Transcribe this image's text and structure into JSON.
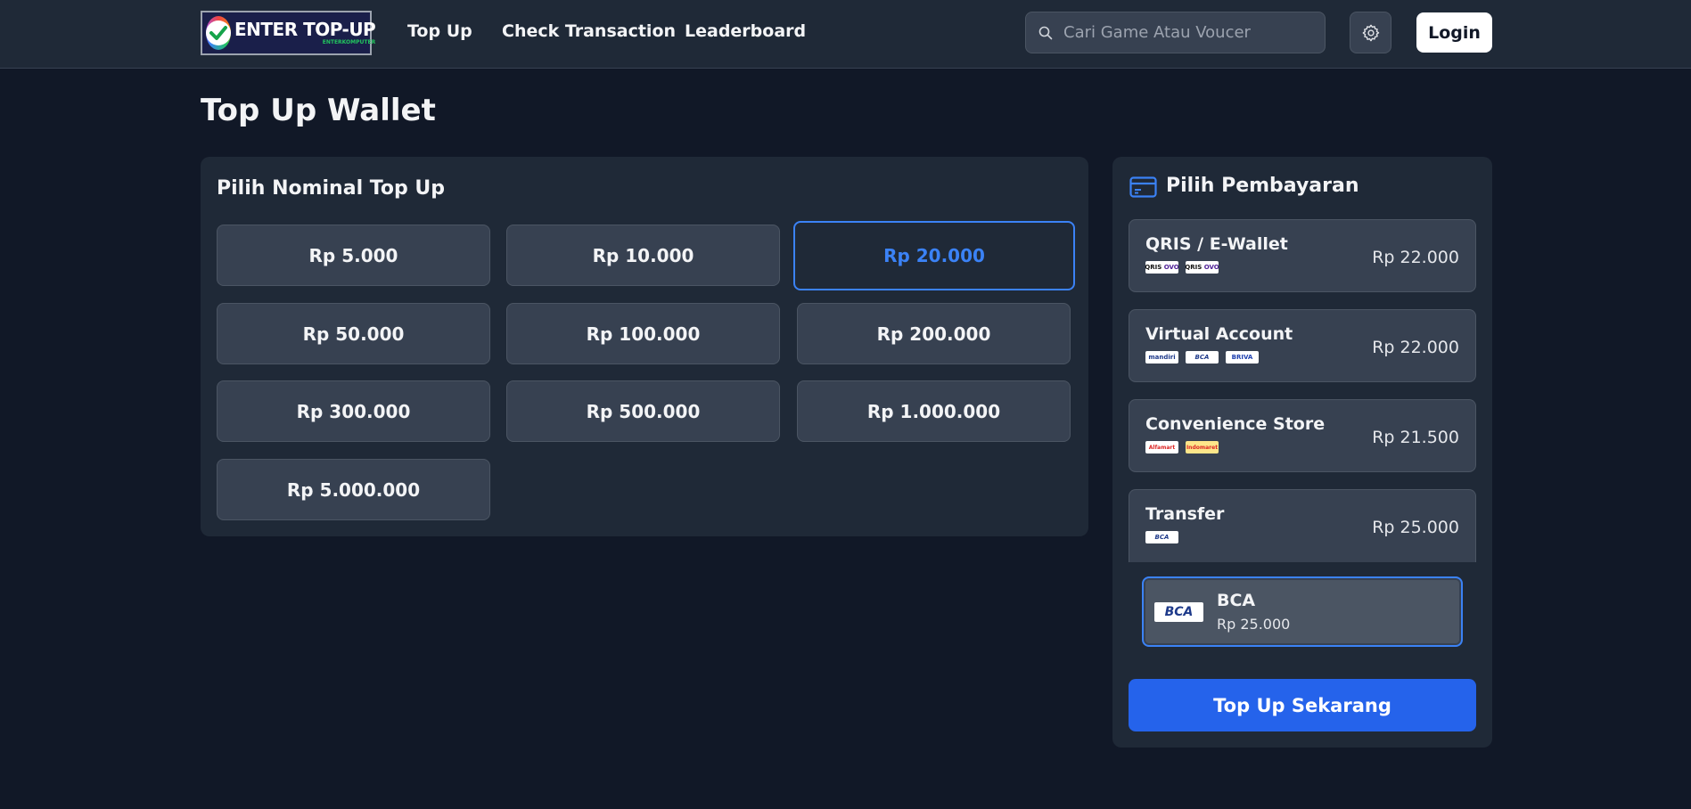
{
  "header": {
    "logo_text": "ENTER TOP-UP",
    "logo_subtext": "ENTERKOMPUTER",
    "nav": [
      {
        "label": "Top Up"
      },
      {
        "label": "Check Transaction"
      },
      {
        "label": "Leaderboard"
      }
    ],
    "search_placeholder": "Cari Game Atau Voucer",
    "settings_icon": "gear-icon",
    "login_label": "Login"
  },
  "page": {
    "title": "Top Up Wallet"
  },
  "nominal": {
    "heading": "Pilih Nominal Top Up",
    "selected_index": 2,
    "options": [
      {
        "label": "Rp 5.000"
      },
      {
        "label": "Rp 10.000"
      },
      {
        "label": "Rp 20.000"
      },
      {
        "label": "Rp 50.000"
      },
      {
        "label": "Rp 100.000"
      },
      {
        "label": "Rp 200.000"
      },
      {
        "label": "Rp 300.000"
      },
      {
        "label": "Rp 500.000"
      },
      {
        "label": "Rp 1.000.000"
      },
      {
        "label": "Rp 5.000.000"
      }
    ]
  },
  "payment": {
    "heading": "Pilih Pembayaran",
    "heading_icon": "credit-card-icon",
    "methods": [
      {
        "name": "QRIS / E-Wallet",
        "price": "Rp 22.000",
        "logos": [
          "QRIS",
          "OVO",
          "QRIS",
          "OVO"
        ]
      },
      {
        "name": "Virtual Account",
        "price": "Rp 22.000",
        "logos": [
          "mandiri",
          "BCA",
          "BRIVA"
        ]
      },
      {
        "name": "Convenience Store",
        "price": "Rp 21.500",
        "logos": [
          "Alfamart",
          "Indomaret"
        ]
      },
      {
        "name": "Transfer",
        "price": "Rp 25.000",
        "logos": [
          "BCA"
        ]
      }
    ],
    "selected_option": {
      "name": "BCA",
      "price": "Rp 25.000",
      "logo": "BCA"
    },
    "submit_label": "Top Up Sekarang"
  },
  "colors": {
    "background": "#111827",
    "panel": "#1f2937",
    "card": "#374151",
    "accent": "#3b82f6",
    "primary_button": "#2563eb"
  }
}
